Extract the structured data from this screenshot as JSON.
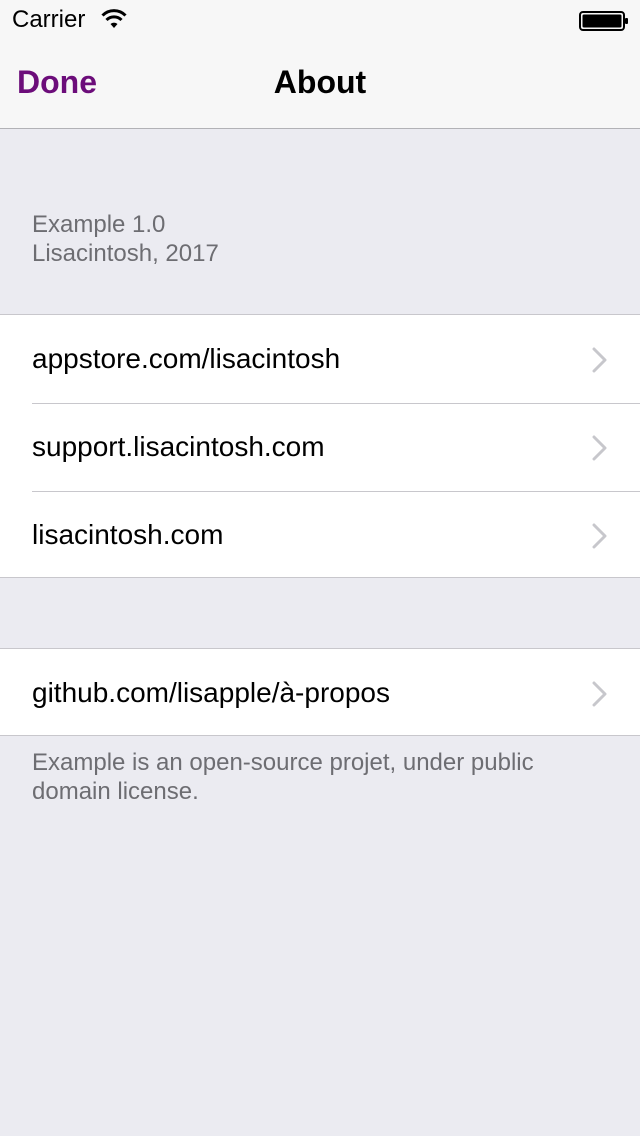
{
  "status_bar": {
    "carrier": "Carrier"
  },
  "nav": {
    "done_label": "Done",
    "title": "About"
  },
  "header": {
    "version": "Example 1.0",
    "author_year": "Lisacintosh, 2017"
  },
  "links_group_1": [
    {
      "label": "appstore.com/lisacintosh",
      "icon": "chevron-right-icon"
    },
    {
      "label": "support.lisacintosh.com",
      "icon": "chevron-right-icon"
    },
    {
      "label": "lisacintosh.com",
      "icon": "chevron-right-icon"
    }
  ],
  "links_group_2": [
    {
      "label": "github.com/lisapple/à-propos",
      "icon": "chevron-right-icon"
    }
  ],
  "footer": {
    "text": "Example is an open-source projet, under public domain license."
  },
  "colors": {
    "accent": "#6c0d7a",
    "background": "#ebebf1",
    "secondary_text": "#6d6d72"
  }
}
